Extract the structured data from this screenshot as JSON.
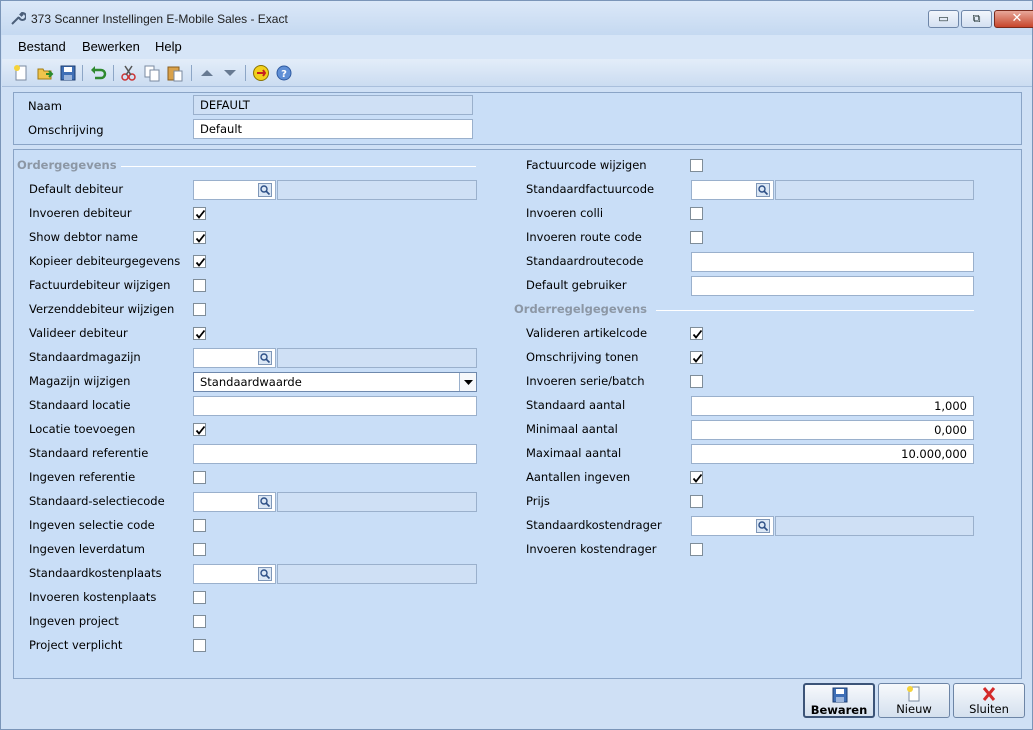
{
  "window": {
    "title": "373 Scanner Instellingen E-Mobile Sales - Exact"
  },
  "titlebar_buttons": {
    "minimize": "▭",
    "restore": "⧉",
    "close": "✕"
  },
  "menu": [
    "Bestand",
    "Bewerken",
    "Help"
  ],
  "toolbar": {
    "icons": [
      "new-icon",
      "open-icon",
      "save-icon",
      "undo-icon",
      "cut-icon",
      "copy-icon",
      "paste-icon",
      "up-icon",
      "down-icon",
      "exact-logo-icon",
      "help-icon"
    ]
  },
  "header": {
    "naam_label": "Naam",
    "naam_value": "DEFAULT",
    "omschrijving_label": "Omschrijving",
    "omschrijving_value": "Default"
  },
  "left": {
    "section_title": "Ordergegevens",
    "default_debiteur": "Default debiteur",
    "invoeren_debiteur": "Invoeren debiteur",
    "show_debtor_name": "Show debtor name",
    "kopieer_debiteurgegevens": "Kopieer debiteurgegevens",
    "factuurdebiteur_wijzigen": "Factuurdebiteur wijzigen",
    "verzenddebiteur_wijzigen": "Verzenddebiteur wijzigen",
    "valideer_debiteur": "Valideer debiteur",
    "standaardmagazijn": "Standaardmagazijn",
    "magazijn_wijzigen": "Magazijn wijzigen",
    "magazijn_wijzigen_value": "Standaardwaarde",
    "standaard_locatie": "Standaard locatie",
    "locatie_toevoegen": "Locatie toevoegen",
    "standaard_referentie": "Standaard referentie",
    "ingeven_referentie": "Ingeven referentie",
    "standaard_selectiecode": "Standaard-selectiecode",
    "ingeven_selectie_code": "Ingeven selectie code",
    "ingeven_leverdatum": "Ingeven leverdatum",
    "standaardkostenplaats": "Standaardkostenplaats",
    "invoeren_kostenplaats": "Invoeren kostenplaats",
    "ingeven_project": "Ingeven project",
    "project_verplicht": "Project verplicht"
  },
  "right": {
    "factuurcode_wijzigen": "Factuurcode wijzigen",
    "standaardfactuurcode": "Standaardfactuurcode",
    "invoeren_colli": "Invoeren colli",
    "invoeren_route_code": "Invoeren route code",
    "standaardroutecode": "Standaardroutecode",
    "default_gebruiker": "Default gebruiker",
    "section_title": "Orderregelgegevens",
    "valideren_artikelcode": "Valideren artikelcode",
    "omschrijving_tonen": "Omschrijving tonen",
    "invoeren_serie_batch": "Invoeren serie/batch",
    "standaard_aantal": "Standaard aantal",
    "standaard_aantal_value": "1,000",
    "minimaal_aantal": "Minimaal aantal",
    "minimaal_aantal_value": "0,000",
    "maximaal_aantal": "Maximaal aantal",
    "maximaal_aantal_value": "10.000,000",
    "aantallen_ingeven": "Aantallen ingeven",
    "prijs": "Prijs",
    "standaardkostendrager": "Standaardkostendrager",
    "invoeren_kostendrager": "Invoeren kostendrager"
  },
  "checks": {
    "invoeren_debiteur": true,
    "show_debtor_name": true,
    "kopieer_debiteurgegevens": true,
    "factuurdebiteur_wijzigen": false,
    "verzenddebiteur_wijzigen": false,
    "valideer_debiteur": true,
    "locatie_toevoegen": true,
    "ingeven_referentie": false,
    "ingeven_selectie_code": false,
    "ingeven_leverdatum": false,
    "invoeren_kostenplaats": false,
    "ingeven_project": false,
    "project_verplicht": false,
    "factuurcode_wijzigen": false,
    "invoeren_colli": false,
    "invoeren_route_code": false,
    "valideren_artikelcode": true,
    "omschrijving_tonen": true,
    "invoeren_serie_batch": false,
    "aantallen_ingeven": true,
    "prijs": false,
    "invoeren_kostendrager": false
  },
  "buttons": {
    "bewaren": "Bewaren",
    "nieuw": "Nieuw",
    "sluiten": "Sluiten"
  },
  "colors": {
    "accent": "#c9def7",
    "close_red": "#c7452b"
  }
}
